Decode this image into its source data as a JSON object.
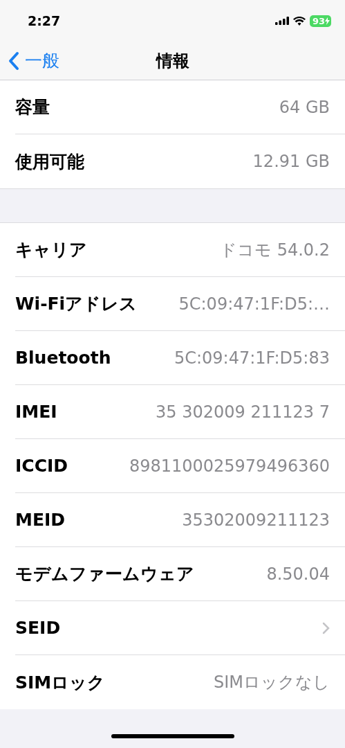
{
  "status_bar": {
    "time": "2:27",
    "battery": "93"
  },
  "nav": {
    "back": "一般",
    "title": "情報"
  },
  "groups": [
    {
      "rows": [
        {
          "kind": "value",
          "label": "容量",
          "value": "64 GB"
        },
        {
          "kind": "value",
          "label": "使用可能",
          "value": "12.91 GB"
        }
      ]
    },
    {
      "rows": [
        {
          "kind": "value",
          "label": "キャリア",
          "value": "ドコモ 54.0.2"
        },
        {
          "kind": "value",
          "label": "Wi-Fiアドレス",
          "value": "5C:09:47:1F:D5:…"
        },
        {
          "kind": "value",
          "label": "Bluetooth",
          "value": "5C:09:47:1F:D5:83"
        },
        {
          "kind": "value",
          "label": "IMEI",
          "value": "35 302009 211123 7"
        },
        {
          "kind": "value",
          "label": "ICCID",
          "value": "8981100025979496360"
        },
        {
          "kind": "value",
          "label": "MEID",
          "value": "35302009211123"
        },
        {
          "kind": "value",
          "label": "モデムファームウェア",
          "value": "8.50.04"
        },
        {
          "kind": "disclosure",
          "label": "SEID"
        },
        {
          "kind": "value",
          "label": "SIMロック",
          "value": "SIMロックなし"
        }
      ]
    }
  ]
}
